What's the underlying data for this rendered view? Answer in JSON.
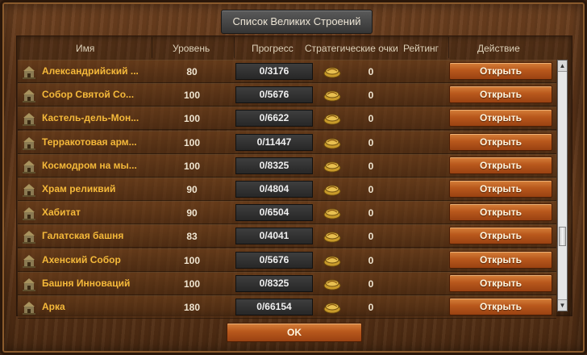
{
  "dialog": {
    "title": "Список Великих Строений",
    "ok_label": "OK"
  },
  "table": {
    "headers": {
      "name": "Имя",
      "level": "Уровень",
      "progress": "Прогресс",
      "strategic_points": "Стратегические очки",
      "rating": "Рейтинг",
      "action": "Действие"
    },
    "rows": [
      {
        "name": "Александрийский ...",
        "level": "80",
        "progress": "0/3176",
        "sp": "0",
        "action": "Открыть",
        "icon": "lighthouse-icon"
      },
      {
        "name": "Собор Святой Со...",
        "level": "100",
        "progress": "0/5676",
        "sp": "0",
        "action": "Открыть",
        "icon": "cathedral-icon"
      },
      {
        "name": "Кастель-дель-Мон...",
        "level": "100",
        "progress": "0/6622",
        "sp": "0",
        "action": "Открыть",
        "icon": "castle-icon"
      },
      {
        "name": "Терракотовая арм...",
        "level": "100",
        "progress": "0/11447",
        "sp": "0",
        "action": "Открыть",
        "icon": "army-icon"
      },
      {
        "name": "Космодром на мы...",
        "level": "100",
        "progress": "0/8325",
        "sp": "0",
        "action": "Открыть",
        "icon": "spaceport-icon"
      },
      {
        "name": "Храм реликвий",
        "level": "90",
        "progress": "0/4804",
        "sp": "0",
        "action": "Открыть",
        "icon": "temple-icon"
      },
      {
        "name": "Хабитат",
        "level": "90",
        "progress": "0/6504",
        "sp": "0",
        "action": "Открыть",
        "icon": "habitat-icon"
      },
      {
        "name": "Галатская башня",
        "level": "83",
        "progress": "0/4041",
        "sp": "0",
        "action": "Открыть",
        "icon": "tower-icon"
      },
      {
        "name": "Ахенский Собор",
        "level": "100",
        "progress": "0/5676",
        "sp": "0",
        "action": "Открыть",
        "icon": "cathedral-icon"
      },
      {
        "name": "Башня Инноваций",
        "level": "100",
        "progress": "0/8325",
        "sp": "0",
        "action": "Открыть",
        "icon": "innovation-tower-icon"
      },
      {
        "name": "Арка",
        "level": "180",
        "progress": "0/66154",
        "sp": "0",
        "action": "Открыть",
        "icon": "arch-icon"
      }
    ]
  },
  "colors": {
    "name_text": "#f5b93a",
    "button": "#b8581c",
    "frame_wood": "#5a3318"
  }
}
